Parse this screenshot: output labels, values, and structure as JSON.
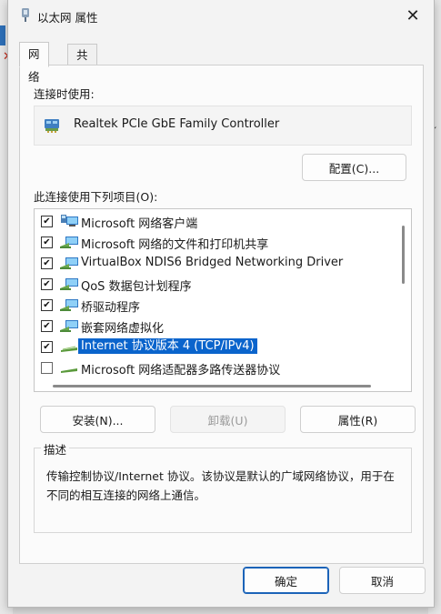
{
  "window": {
    "title": "以太网 属性"
  },
  "tabs": [
    {
      "label": "网络"
    },
    {
      "label": "共享"
    }
  ],
  "connect_using": {
    "label": "连接时使用:",
    "adapter_name": "Realtek PCIe GbE Family Controller",
    "configure_button": "配置(C)..."
  },
  "items_section": {
    "label": "此连接使用下列项目(O):",
    "items": [
      {
        "label": "Microsoft 网络客户端",
        "checked": true,
        "icon": "network-client-icon"
      },
      {
        "label": "Microsoft 网络的文件和打印机共享",
        "checked": true,
        "icon": "network-service-icon"
      },
      {
        "label": "VirtualBox NDIS6 Bridged Networking Driver",
        "checked": true,
        "icon": "network-service-icon"
      },
      {
        "label": "QoS 数据包计划程序",
        "checked": true,
        "icon": "network-service-icon"
      },
      {
        "label": "桥驱动程序",
        "checked": true,
        "icon": "network-service-icon"
      },
      {
        "label": "嵌套网络虚拟化",
        "checked": true,
        "icon": "network-service-icon"
      },
      {
        "label": "Internet 协议版本 4 (TCP/IPv4)",
        "checked": true,
        "selected": true,
        "icon": "protocol-icon"
      },
      {
        "label": "Microsoft 网络适配器多路传送器协议",
        "checked": false,
        "icon": "protocol-icon"
      }
    ]
  },
  "buttons": {
    "install": "安装(N)...",
    "uninstall": "卸载(U)",
    "properties": "属性(R)",
    "ok": "确定",
    "cancel": "取消"
  },
  "description": {
    "title": "描述",
    "text": "传输控制协议/Internet 协议。该协议是默认的广域网络协议，用于在不同的相互连接的网络上通信。"
  },
  "colors": {
    "selection": "#0a64cc",
    "accent": "#1b63b8"
  }
}
